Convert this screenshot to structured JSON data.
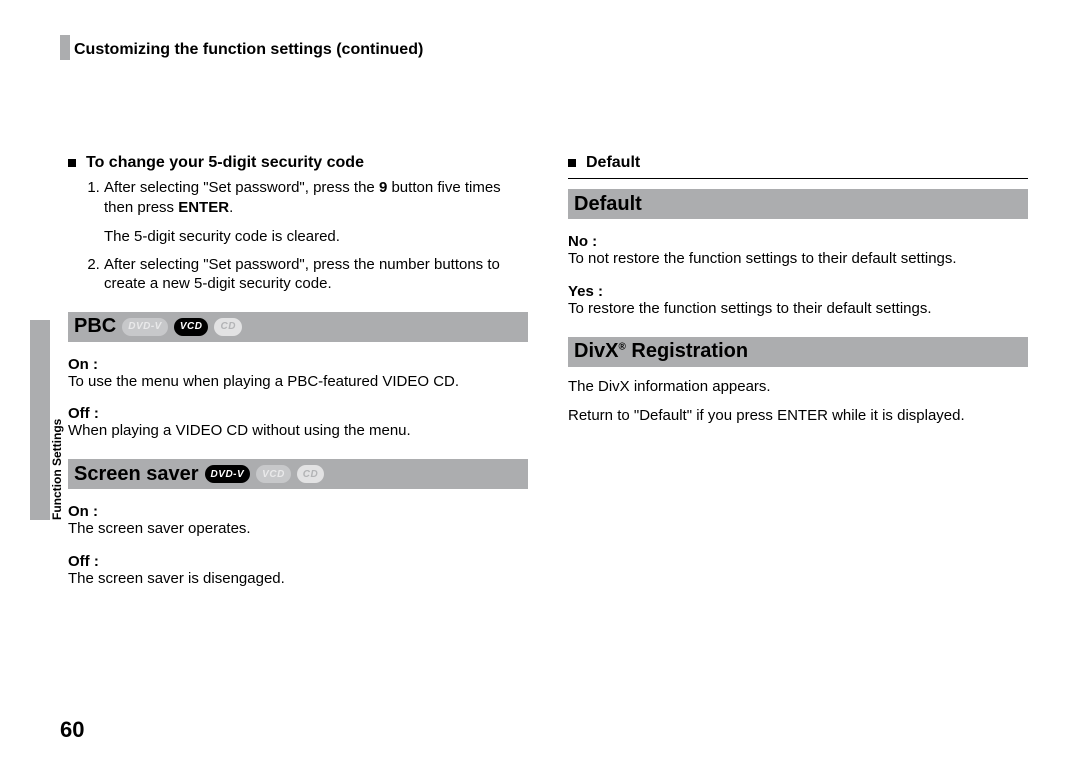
{
  "header": {
    "title": "Customizing the function settings (continued)"
  },
  "side_label": "Function Settings",
  "page_number": "60",
  "left": {
    "security_heading": "To change your 5-digit security code",
    "step1_pre": "After selecting \"Set password\", press the ",
    "step1_bold": "9",
    "step1_post": " button five times then press ",
    "step1_enter": "ENTER",
    "step1_tail": ".",
    "step1_result": "The 5-digit security code is cleared.",
    "step2": "After selecting \"Set password\", press the number buttons to create a new 5-digit security code.",
    "pbc": {
      "title": "PBC",
      "pills": [
        "DVD-V",
        "VCD",
        "CD"
      ],
      "on_label": "On :",
      "on_text": "To use the menu when playing a PBC-featured VIDEO CD.",
      "off_label": "Off :",
      "off_text": "When playing a VIDEO CD without using the menu."
    },
    "screensaver": {
      "title": "Screen saver",
      "pills": [
        "DVD-V",
        "VCD",
        "CD"
      ],
      "on_label": "On :",
      "on_text": "The screen saver operates.",
      "off_label": "Off :",
      "off_text": "The screen saver is disengaged."
    }
  },
  "right": {
    "default_mini": "Default",
    "default_bar": "Default",
    "no_label": "No :",
    "no_text": "To not restore the function settings to their default settings.",
    "yes_label": "Yes :",
    "yes_text": "To restore the function settings to their default settings.",
    "divx_title_pre": "DivX",
    "divx_title_post": " Registration",
    "divx_p1": "The DivX information appears.",
    "divx_p2": "Return to \"Default\" if you press ENTER while it is displayed."
  }
}
